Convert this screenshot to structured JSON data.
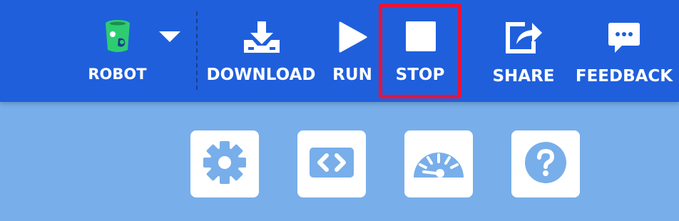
{
  "toolbar": {
    "robot": {
      "label": "ROBOT",
      "icon": "robot-can-icon",
      "dropdown_icon": "caret-down-icon"
    },
    "download": {
      "label": "DOWNLOAD",
      "icon": "download-tray-icon"
    },
    "run": {
      "label": "RUN",
      "icon": "play-icon"
    },
    "stop": {
      "label": "STOP",
      "icon": "stop-square-icon",
      "highlighted": true
    },
    "share": {
      "label": "SHARE",
      "icon": "share-arrow-icon"
    },
    "feedback": {
      "label": "FEEDBACK",
      "icon": "chat-bubble-icon"
    }
  },
  "tiles": [
    {
      "icon": "gear-icon"
    },
    {
      "icon": "code-brackets-icon"
    },
    {
      "icon": "speedometer-icon"
    },
    {
      "icon": "help-question-icon"
    }
  ],
  "colors": {
    "toolbar_bg": "#1f5fdc",
    "page_bg": "#78aeea",
    "tile_bg": "#ffffff",
    "tile_icon": "#78aeea",
    "highlight": "#e8133a",
    "robot_accent": "#2ecc71"
  }
}
